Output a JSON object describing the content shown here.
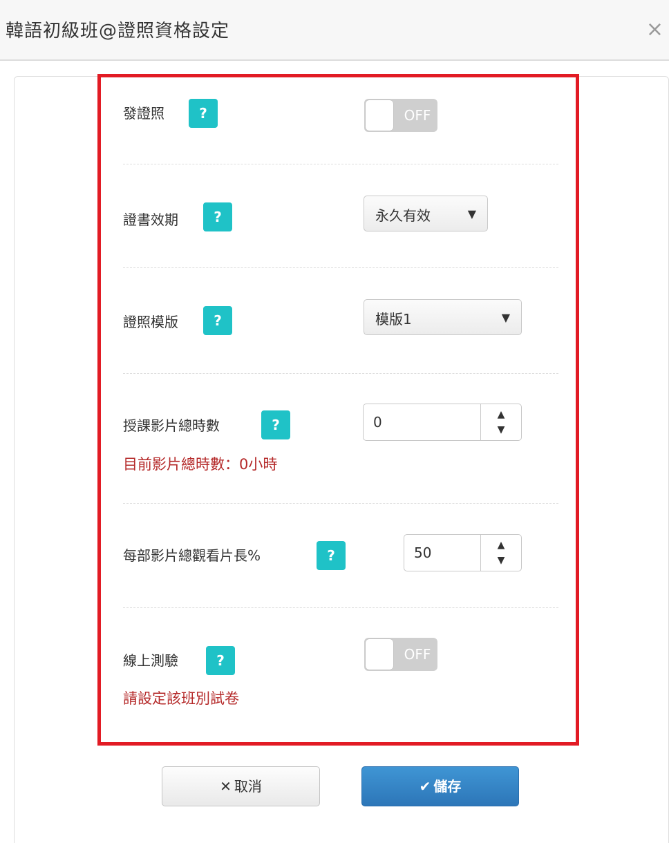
{
  "header": {
    "title": "韓語初級班@證照資格設定",
    "close_symbol": "×"
  },
  "form": {
    "certificate": {
      "label": "發證照",
      "help": "?",
      "toggle_text": "OFF",
      "enabled": false
    },
    "validity": {
      "label": "證書效期",
      "help": "?",
      "selected": "永久有效",
      "caret": "▼"
    },
    "template": {
      "label": "證照模版",
      "help": "?",
      "selected": "模版1",
      "caret": "▼"
    },
    "total_hours": {
      "label": "授課影片總時數",
      "help": "?",
      "value": "0",
      "hint": "目前影片總時數：0小時",
      "up": "▲",
      "down": "▼"
    },
    "watch_percent": {
      "label": "每部影片總觀看片長%",
      "help": "?",
      "value": "50",
      "up": "▲",
      "down": "▼"
    },
    "online_test": {
      "label": "線上測驗",
      "help": "?",
      "toggle_text": "OFF",
      "enabled": false,
      "hint": "請設定該班別試卷"
    }
  },
  "buttons": {
    "cancel_icon": "✕",
    "cancel_label": "取消",
    "save_icon": "✔",
    "save_label": "儲存"
  },
  "colors": {
    "help_button": "#1fc2c7",
    "highlight_border": "#e21b24",
    "hint_text": "#b52a2a",
    "save_button": "#2d76b8"
  }
}
